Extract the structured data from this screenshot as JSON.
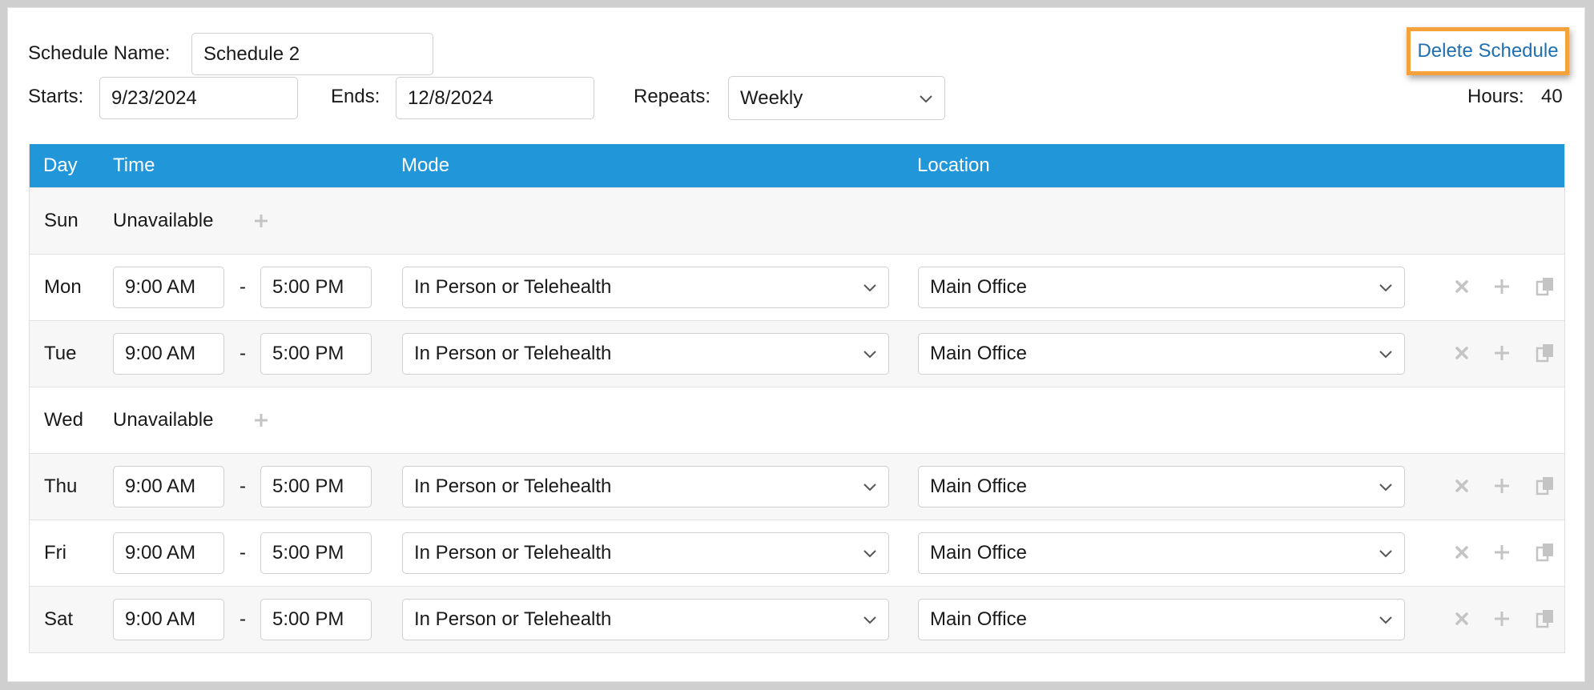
{
  "header": {
    "schedule_name_label": "Schedule Name:",
    "schedule_name_value": "Schedule 2",
    "starts_label": "Starts:",
    "starts_value": "9/23/2024",
    "ends_label": "Ends:",
    "ends_value": "12/8/2024",
    "repeats_label": "Repeats:",
    "repeats_value": "Weekly",
    "hours_label": "Hours:",
    "hours_value": "40",
    "delete_label": "Delete Schedule"
  },
  "table": {
    "columns": [
      "Day",
      "Time",
      "Mode",
      "Location"
    ],
    "rows": [
      {
        "day": "Sun",
        "unavailable": "Unavailable"
      },
      {
        "day": "Mon",
        "start": "9:00 AM",
        "sep": "-",
        "end": "5:00 PM",
        "mode": "In Person or Telehealth",
        "location": "Main Office"
      },
      {
        "day": "Tue",
        "start": "9:00 AM",
        "sep": "-",
        "end": "5:00 PM",
        "mode": "In Person or Telehealth",
        "location": "Main Office"
      },
      {
        "day": "Wed",
        "unavailable": "Unavailable"
      },
      {
        "day": "Thu",
        "start": "9:00 AM",
        "sep": "-",
        "end": "5:00 PM",
        "mode": "In Person or Telehealth",
        "location": "Main Office"
      },
      {
        "day": "Fri",
        "start": "9:00 AM",
        "sep": "-",
        "end": "5:00 PM",
        "mode": "In Person or Telehealth",
        "location": "Main Office"
      },
      {
        "day": "Sat",
        "start": "9:00 AM",
        "sep": "-",
        "end": "5:00 PM",
        "mode": "In Person or Telehealth",
        "location": "Main Office"
      }
    ]
  },
  "colors": {
    "header_bg": "#2196d8",
    "link": "#1f6fb2",
    "highlight_border": "#f5a13c",
    "icon_muted": "#c4c4c4"
  },
  "icons": {
    "remove": "close-icon",
    "add": "plus-icon",
    "copy": "copy-icon",
    "dropdown": "chevron-down-icon"
  }
}
